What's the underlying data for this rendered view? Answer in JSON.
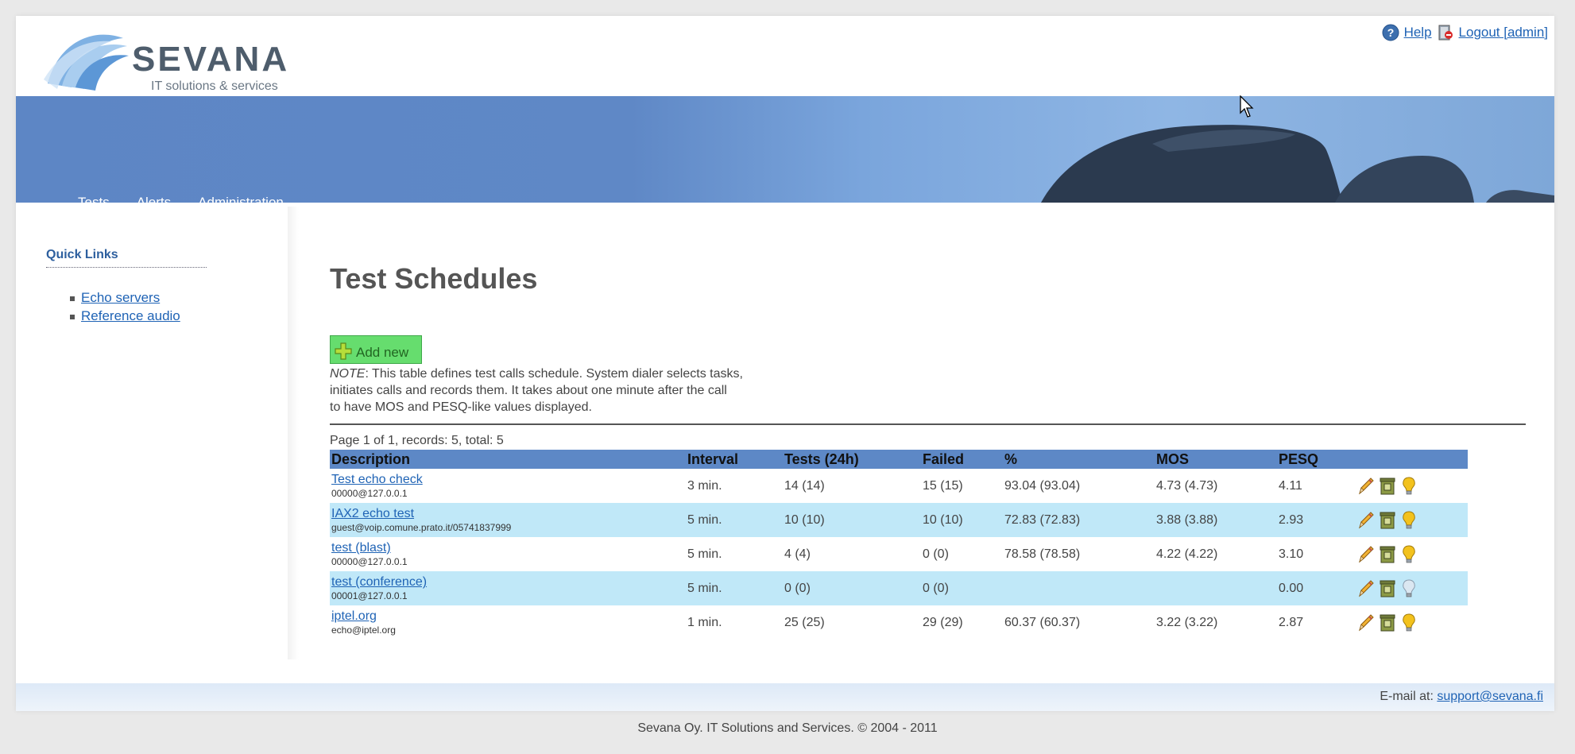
{
  "header": {
    "logo_name": "SEVANA",
    "logo_tagline": "IT solutions & services",
    "help_label": "Help",
    "logout_label": "Logout [admin]"
  },
  "nav": {
    "items": [
      "Tests",
      "Alerts",
      "Administration"
    ]
  },
  "sidebar": {
    "title": "Quick Links",
    "links": [
      "Echo servers",
      "Reference audio"
    ]
  },
  "main": {
    "title": "Test Schedules",
    "add_new_label": "Add new",
    "note_prefix": "NOTE",
    "note_line1": ": This table defines test calls schedule. System dialer selects tasks,",
    "note_line2": "initiates calls and records them. It takes about one minute after the call",
    "note_line3": "to have MOS and PESQ-like values displayed.",
    "pager": "Page 1 of 1, records: 5, total: 5"
  },
  "table": {
    "headers": [
      "Description",
      "Interval",
      "Tests (24h)",
      "Failed",
      "%",
      "MOS",
      "PESQ",
      ""
    ],
    "rows": [
      {
        "name": "Test echo check",
        "sub": "00000@127.0.0.1",
        "interval": "3 min.",
        "tests": "14 (14)",
        "failed": "15 (15)",
        "pct": "93.04 (93.04)",
        "mos": "4.73 (4.73)",
        "pesq": "4.11",
        "bulb_on": true
      },
      {
        "name": "IAX2 echo test",
        "sub": "guest@voip.comune.prato.it/05741837999",
        "interval": "5 min.",
        "tests": "10 (10)",
        "failed": "10 (10)",
        "pct": "72.83 (72.83)",
        "mos": "3.88 (3.88)",
        "pesq": "2.93",
        "bulb_on": true
      },
      {
        "name": "test (blast)",
        "sub": "00000@127.0.0.1",
        "interval": "5 min.",
        "tests": "4 (4)",
        "failed": "0 (0)",
        "pct": "78.58 (78.58)",
        "mos": "4.22 (4.22)",
        "pesq": "3.10",
        "bulb_on": true
      },
      {
        "name": "test (conference)",
        "sub": "00001@127.0.0.1",
        "interval": "5 min.",
        "tests": "0 (0)",
        "failed": "0 (0)",
        "pct": "",
        "mos": "",
        "pesq": "0.00",
        "bulb_on": false
      },
      {
        "name": "iptel.org",
        "sub": "echo@iptel.org",
        "interval": "1 min.",
        "tests": "25 (25)",
        "failed": "29 (29)",
        "pct": "60.37 (60.37)",
        "mos": "3.22 (3.22)",
        "pesq": "2.87",
        "bulb_on": true
      }
    ]
  },
  "footer": {
    "contact_label": "E-mail at:",
    "contact_email": "support@sevana.fi",
    "copyright": "Sevana Oy. IT Solutions and Services. © 2004 - 2011"
  },
  "icons": {
    "help": "help-icon",
    "logout": "logout-icon",
    "add": "plus-icon",
    "edit": "pencil-icon",
    "delete": "trash-icon",
    "status": "lightbulb-icon"
  },
  "colors": {
    "nav_bar": "#5d88c6",
    "row_alt": "#c0e8f8",
    "add_button": "#66dd6e",
    "link": "#1f63b5"
  }
}
